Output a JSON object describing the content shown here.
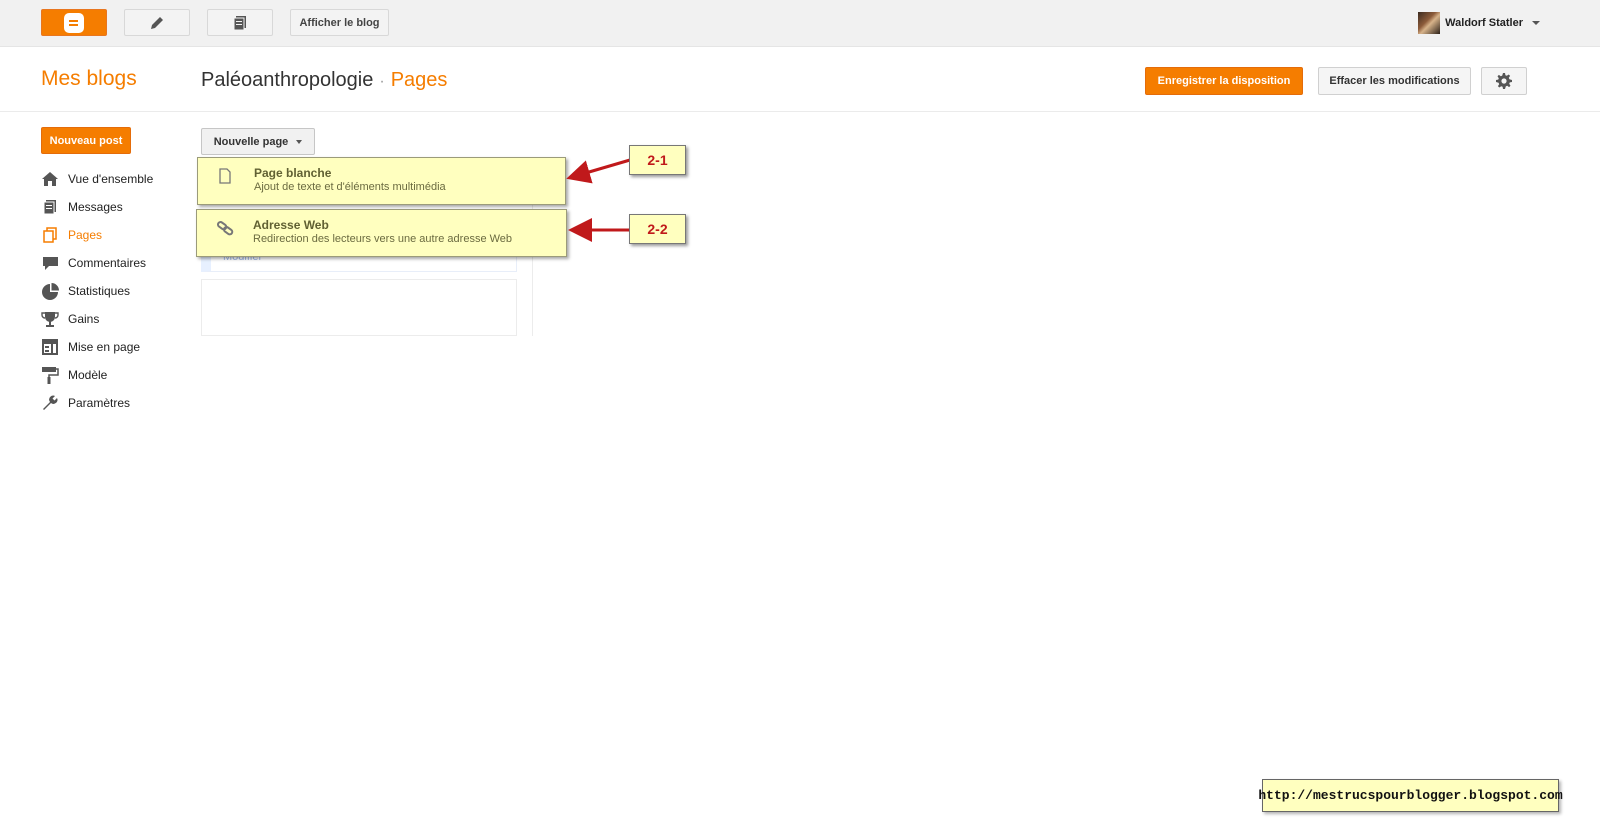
{
  "topbar": {
    "logo_icon": "blogger-logo-icon",
    "compose_icon": "pencil-icon",
    "posts_icon": "posts-icon",
    "view_blog_label": "Afficher le blog",
    "user_name": "Waldorf Statler"
  },
  "header": {
    "mes_blogs": "Mes blogs",
    "blog_title": "Paléoanthropologie",
    "separator": "·",
    "section": "Pages",
    "save_layout_label": "Enregistrer la disposition",
    "clear_label": "Effacer les modifications"
  },
  "sidebar": {
    "new_post_label": "Nouveau post",
    "items": [
      {
        "label": "Vue d'ensemble",
        "icon": "home-icon"
      },
      {
        "label": "Messages",
        "icon": "posts-icon"
      },
      {
        "label": "Pages",
        "icon": "pages-icon",
        "active": true
      },
      {
        "label": "Commentaires",
        "icon": "comment-icon"
      },
      {
        "label": "Statistiques",
        "icon": "pie-chart-icon"
      },
      {
        "label": "Gains",
        "icon": "trophy-icon"
      },
      {
        "label": "Mise en page",
        "icon": "layout-icon"
      },
      {
        "label": "Modèle",
        "icon": "paint-roller-icon"
      },
      {
        "label": "Paramètres",
        "icon": "wrench-icon"
      }
    ]
  },
  "main": {
    "new_page_label": "Nouvelle page",
    "menu": [
      {
        "title": "Page blanche",
        "desc": "Ajout de texte et d'éléments multimédia",
        "icon": "blank-page-icon"
      },
      {
        "title": "Adresse Web",
        "desc": "Redirection des lecteurs vers une autre adresse Web",
        "icon": "link-icon"
      }
    ],
    "ghost_edit_link": "Modifier"
  },
  "annotations": {
    "callout_1": "2-1",
    "callout_2": "2-2",
    "url": "http://mestrucspourblogger.blogspot.com"
  },
  "colors": {
    "accent": "#f57d00",
    "highlight": "#ffffbf",
    "arrow": "#c0191b"
  }
}
